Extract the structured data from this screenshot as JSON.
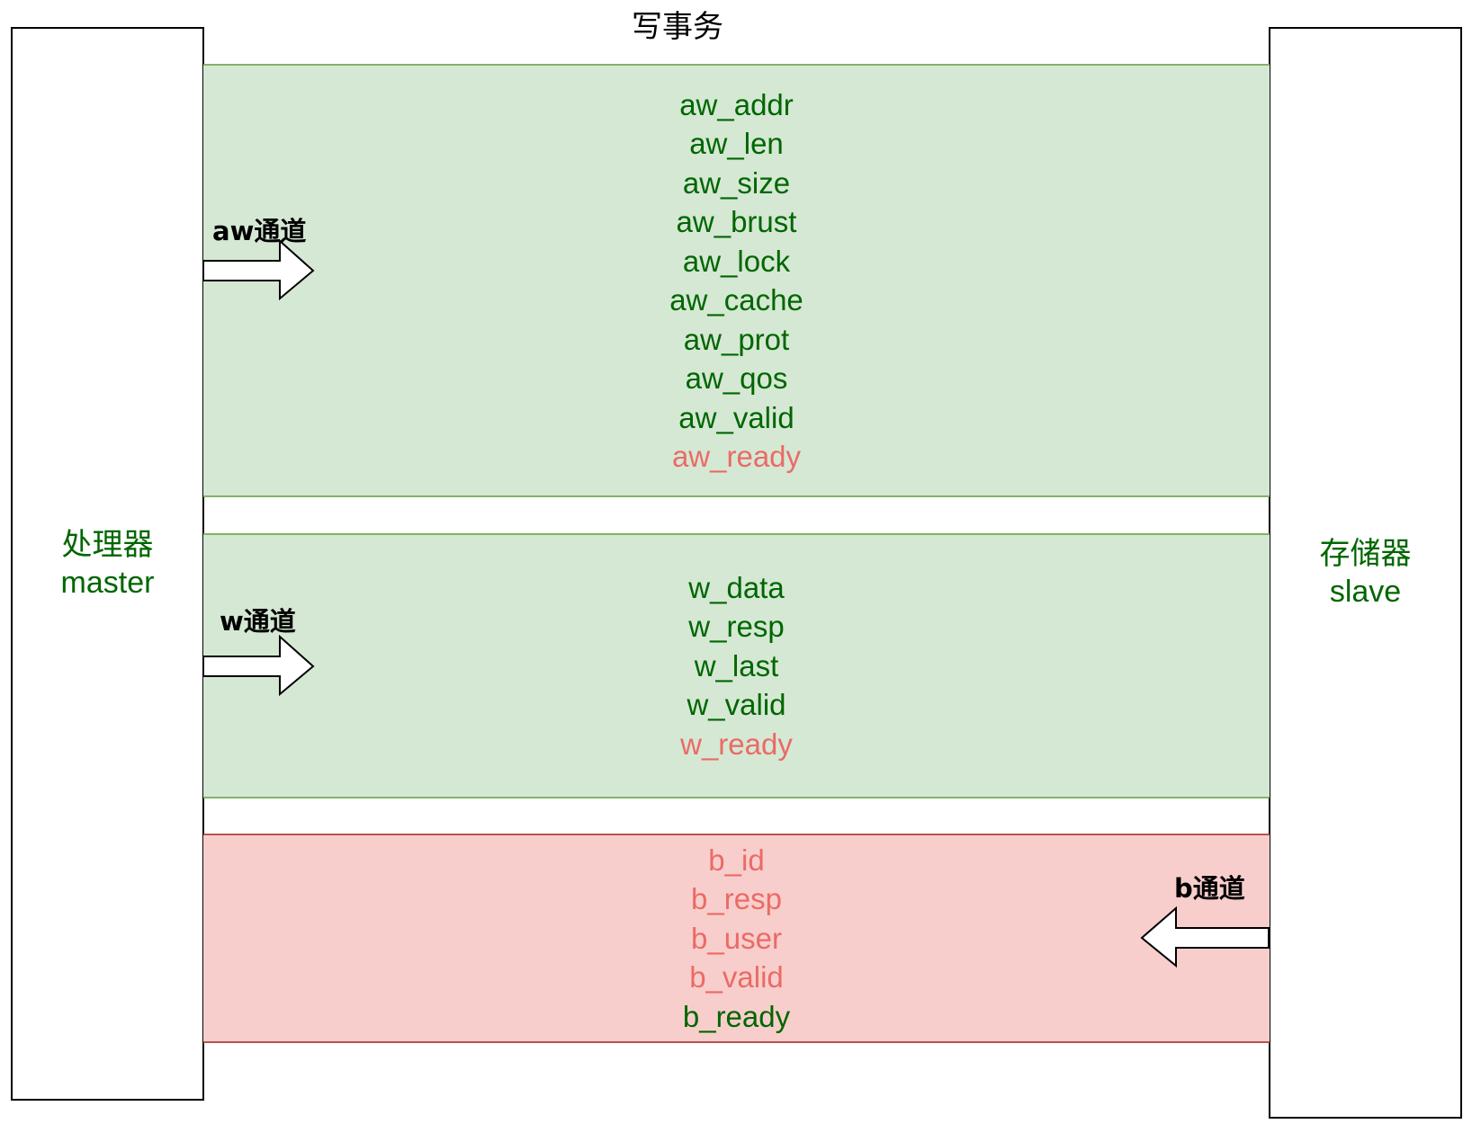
{
  "title": "写事务",
  "master": {
    "line1": "处理器",
    "line2": "master"
  },
  "slave": {
    "line1": "存储器",
    "line2": "slave"
  },
  "channels": {
    "aw": {
      "label": "aw通道",
      "direction": "master-to-slave",
      "signals": [
        {
          "text": "aw_addr",
          "color": "green"
        },
        {
          "text": "aw_len",
          "color": "green"
        },
        {
          "text": "aw_size",
          "color": "green"
        },
        {
          "text": "aw_brust",
          "color": "green"
        },
        {
          "text": "aw_lock",
          "color": "green"
        },
        {
          "text": "aw_cache",
          "color": "green"
        },
        {
          "text": "aw_prot",
          "color": "green"
        },
        {
          "text": "aw_qos",
          "color": "green"
        },
        {
          "text": "aw_valid",
          "color": "green"
        },
        {
          "text": "aw_ready",
          "color": "red"
        }
      ]
    },
    "w": {
      "label": "w通道",
      "direction": "master-to-slave",
      "signals": [
        {
          "text": "w_data",
          "color": "green"
        },
        {
          "text": "w_resp",
          "color": "green"
        },
        {
          "text": "w_last",
          "color": "green"
        },
        {
          "text": "w_valid",
          "color": "green"
        },
        {
          "text": "w_ready",
          "color": "red"
        }
      ]
    },
    "b": {
      "label": "b通道",
      "direction": "slave-to-master",
      "signals": [
        {
          "text": "b_id",
          "color": "red"
        },
        {
          "text": "b_resp",
          "color": "red"
        },
        {
          "text": "b_user",
          "color": "red"
        },
        {
          "text": "b_valid",
          "color": "red"
        },
        {
          "text": "b_ready",
          "color": "green"
        }
      ]
    }
  },
  "colors": {
    "green_text": "#006600",
    "red_text": "#ea6b66",
    "green_fill": "#d5e8d4",
    "green_stroke": "#82b366",
    "red_fill": "#f8cecc",
    "red_stroke": "#b85450"
  }
}
